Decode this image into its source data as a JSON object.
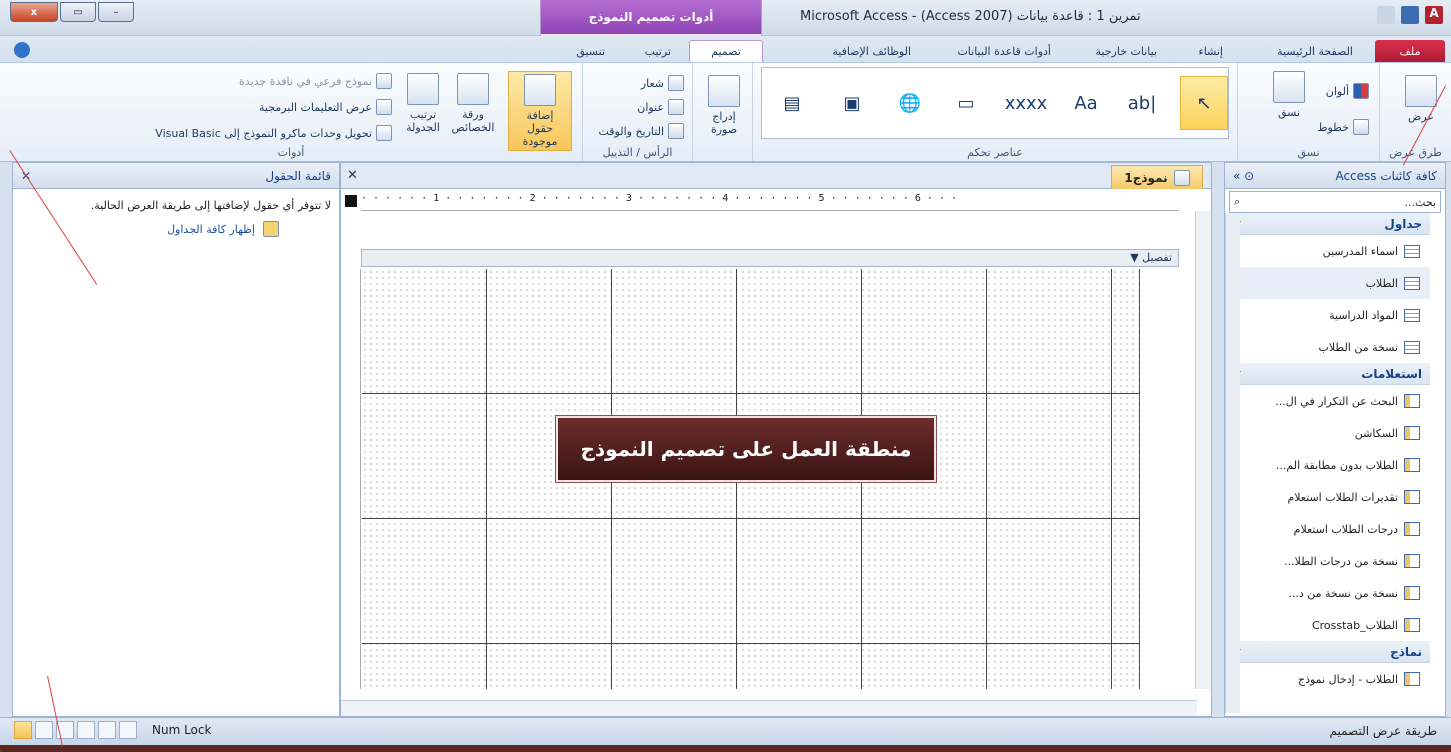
{
  "window": {
    "close_glyph": "x",
    "max_glyph": "▭",
    "min_glyph": "–"
  },
  "title": "Microsoft Access - (Access 2007) تمرين 1 : قاعدة بيانات",
  "contextual_title": "أدوات تصميم النموذج",
  "tabs": [
    "ملف",
    "الصفحة الرئيسية",
    "إنشاء",
    "بيانات خارجية",
    "أدوات قاعدة البيانات",
    "الوظائف الإضافية",
    "تصميم",
    "ترتيب",
    "تنسيق"
  ],
  "ribbon": {
    "views": {
      "btn": "عرض",
      "group": "طرق عرض"
    },
    "themes": {
      "themes": "نسق",
      "colors": "ألوان",
      "fonts": "خطوط",
      "group": "نسق"
    },
    "controls": {
      "group": "عناصر تحكم",
      "items": [
        "↖",
        "ab|",
        "Aa",
        "xxxx",
        "▭",
        "🌐",
        "▣",
        "▤",
        "XYZ"
      ]
    },
    "insert_image": "إدراج صورة",
    "header": {
      "logo": "شعار",
      "title": "عنوان",
      "date": "التاريخ والوقت",
      "group": "الرأس / التذييل"
    },
    "tools": {
      "add_fields": "إضافة حقول موجودة",
      "props": "ورقة الخصائص",
      "tab_order": "ترتيب الجدولة",
      "subform": "نموذج فرعي في نافذة جديدة",
      "view_code": "عرض التعليمات البرمجية",
      "convert": "تحويل وحدات ماكرو النموذج إلى Visual Basic",
      "group": "أدوات"
    }
  },
  "nav": {
    "title": "كافة كائنات Access",
    "search": "بحث...",
    "sections": [
      {
        "name": "جداول",
        "items": [
          "اسماء المدرسين",
          "الطلاب",
          "المواد الدراسية",
          "نسخة من الطلاب"
        ],
        "kind": "table"
      },
      {
        "name": "استعلامات",
        "items": [
          "البحث عن التكرار في ال...",
          "السكاشن",
          "الطلاب بدون مطابقة الم...",
          "تقديرات الطلاب استعلام",
          "درجات الطلاب استعلام",
          "نسخة من درجات الطلا...",
          "نسخة من نسخة من د...",
          "الطلاب_Crosstab"
        ],
        "kind": "query"
      },
      {
        "name": "نماذج",
        "items": [
          "الطلاب - إدخال نموذج"
        ],
        "kind": "form"
      }
    ]
  },
  "doc": {
    "tab": "نموذج1",
    "section": "تفصيل",
    "ruler": "· · · · · · 1 · · · · · · · 2 · · · · · · · 3 · · · · · · · 4 · · · · · · · 5 · · · · · · · 6 · · ·"
  },
  "callout": "منطقة العمل على تصميم النموذج",
  "fieldlist": {
    "title": "قائمة الحقول",
    "message": "لا تتوفر أي حقول لإضافتها إلى طريقة العرض الحالية.",
    "link": "إظهار كافة الجداول"
  },
  "status": {
    "left": "Num Lock",
    "right": "طريقة عرض التصميم"
  }
}
